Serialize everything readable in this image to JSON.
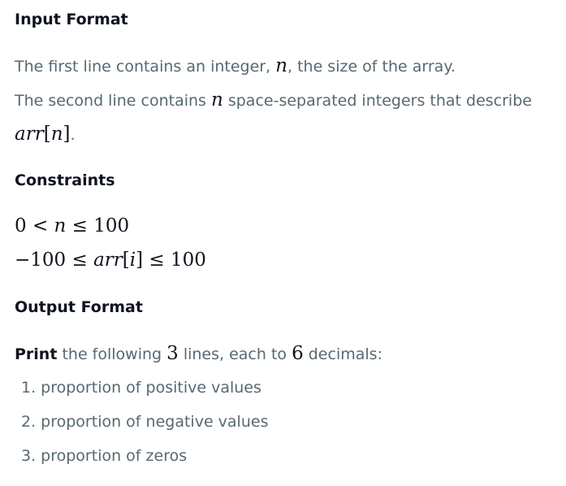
{
  "input_format": {
    "heading": "Input Format",
    "line1_pre": "The first line contains an integer, ",
    "line1_var": "n",
    "line1_post": ", the size of the array.",
    "line2_pre": "The second line contains ",
    "line2_var": "n",
    "line2_post": " space-separated integers that describe",
    "line3_math_arr": "arr",
    "line3_math_open": "[",
    "line3_math_var": "n",
    "line3_math_close": "]",
    "line3_post": "."
  },
  "constraints": {
    "heading": "Constraints",
    "c1": "0 < ",
    "c1_var": "n",
    "c1_post": " ≤ 100",
    "c2_pre": "−100 ≤ ",
    "c2_arr": "arr",
    "c2_open": "[",
    "c2_var": "i",
    "c2_close": "]",
    "c2_post": " ≤ 100"
  },
  "output_format": {
    "heading": "Output Format",
    "print_bold": "Print",
    "pre": " the following ",
    "num_lines": "3",
    "mid": " lines, each to ",
    "num_decimals": "6",
    "post": " decimals:",
    "items": [
      "1. proportion of positive values",
      "2. proportion of negative values",
      "3. proportion of zeros"
    ]
  }
}
